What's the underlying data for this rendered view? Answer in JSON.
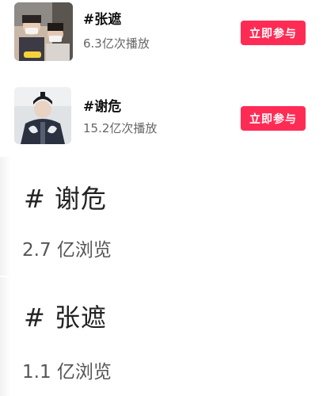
{
  "topics": [
    {
      "title": "#张遮",
      "plays": "6.3亿次播放",
      "button": "立即参与",
      "thumb_icon": "street-photo-thumbnail"
    },
    {
      "title": "#谢危",
      "plays": "15.2亿次播放",
      "button": "立即参与",
      "thumb_icon": "costume-portrait-thumbnail"
    }
  ],
  "cards": [
    {
      "title": "# 谢危",
      "views": "2.7 亿浏览"
    },
    {
      "title": "# 张遮",
      "views": "1.1 亿浏览"
    }
  ],
  "colors": {
    "accent": "#fe2c55",
    "text": "#222222",
    "muted": "#666666"
  }
}
